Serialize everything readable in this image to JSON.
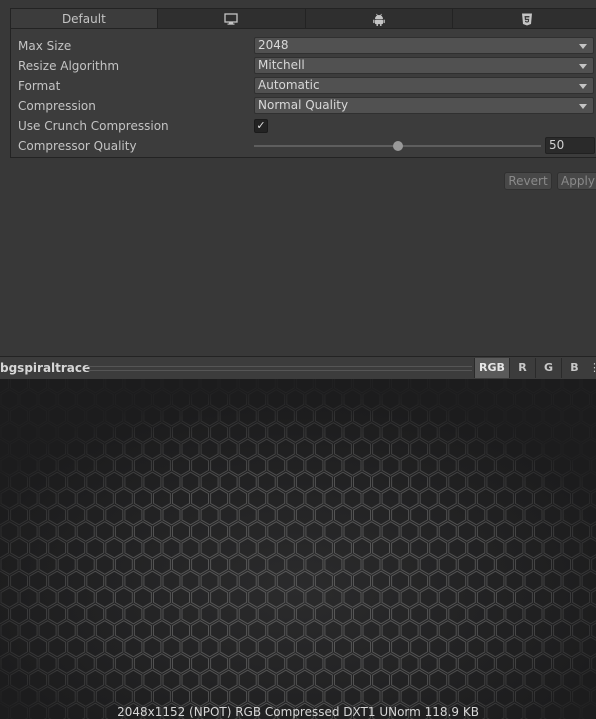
{
  "tabs": [
    {
      "label": "Default",
      "icon": "",
      "active": true
    },
    {
      "label": "",
      "icon": "monitor-icon",
      "active": false
    },
    {
      "label": "",
      "icon": "android-icon",
      "active": false
    },
    {
      "label": "",
      "icon": "html5-icon",
      "active": false
    }
  ],
  "settings": {
    "max_size": {
      "label": "Max Size",
      "value": "2048"
    },
    "resize_algorithm": {
      "label": "Resize Algorithm",
      "value": "Mitchell"
    },
    "format": {
      "label": "Format",
      "value": "Automatic"
    },
    "compression": {
      "label": "Compression",
      "value": "Normal Quality"
    },
    "crunch": {
      "label": "Use Crunch Compression",
      "checked": true,
      "check_glyph": "✓"
    },
    "quality": {
      "label": "Compressor Quality",
      "value": "50",
      "slider_fraction": 0.5
    }
  },
  "buttons": {
    "revert": "Revert",
    "apply": "Apply"
  },
  "preview": {
    "asset_name": "bgspiraltrace",
    "channels": [
      "RGB",
      "R",
      "G",
      "B"
    ],
    "active_channel": "RGB",
    "more_glyph": "⋮",
    "info": "2048x1152 (NPOT)  RGB Compressed DXT1 UNorm   118.9 KB"
  },
  "colors": {
    "background": "#383838",
    "panel": "#3c3c3c",
    "preview_bg": "#1e1e1f",
    "hex_stroke": "#5a5a5a"
  }
}
